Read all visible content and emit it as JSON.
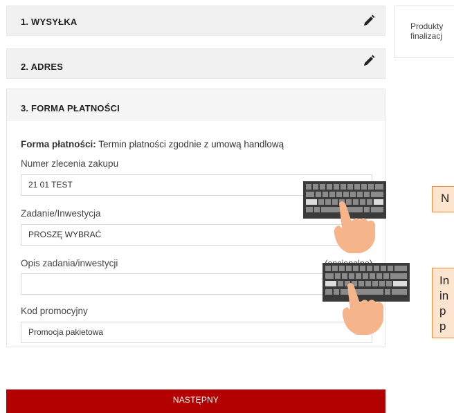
{
  "steps": [
    {
      "title": "1. WYSYŁKA",
      "icon": "pencil-icon"
    },
    {
      "title": "2. ADRES",
      "icon": "pencil-icon"
    },
    {
      "title": "3. FORMA PŁATNOŚCI"
    }
  ],
  "payment": {
    "label": "Forma płatności:",
    "value": "Termin płatności zgodnie z umową handlową"
  },
  "fields": {
    "order_number": {
      "label": "Numer zlecenia zakupu",
      "value": "21 01 TEST"
    },
    "task": {
      "label": "Zadanie/Inwestycja",
      "value": "PROSZĘ WYBRAĆ"
    },
    "task_desc": {
      "label": "Opis zadania/inwestycji",
      "optional": "(opcjonalne)",
      "value": ""
    },
    "promo": {
      "label": "Kod promocyjny",
      "value": "Promocja pakietowa"
    }
  },
  "next_button": "NASTĘPNY",
  "side_panel": {
    "line1": "Produkty",
    "line2": "finalizacj"
  },
  "hints": {
    "box1": "N",
    "box2_lines": [
      "In",
      "in",
      "p",
      "p"
    ]
  },
  "colors": {
    "accent": "#b30000",
    "hint_border": "#f08a3a",
    "hint_fill": "#fde4cf"
  },
  "icons": [
    "pencil-icon",
    "keyboard-icon",
    "hand-pointer-icon"
  ]
}
